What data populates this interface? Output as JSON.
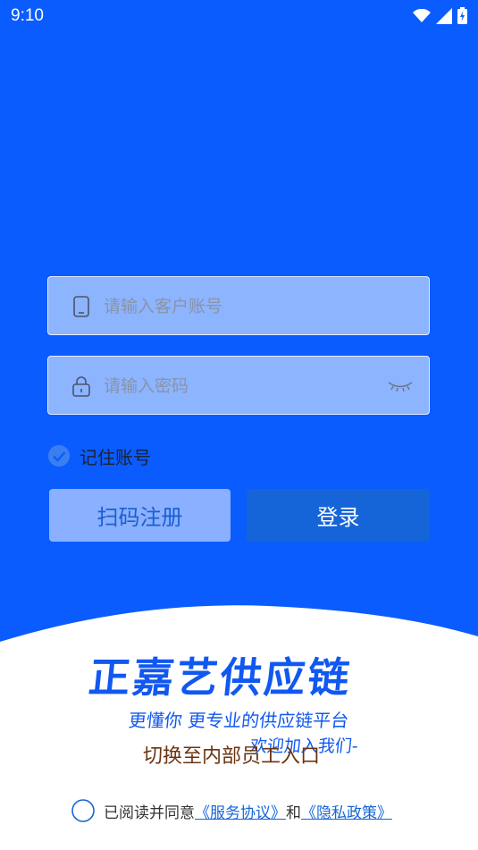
{
  "status_bar": {
    "time": "9:10"
  },
  "login_form": {
    "account_placeholder": "请输入客户账号",
    "password_placeholder": "请输入密码",
    "remember_label": "记住账号",
    "register_label": "扫码注册",
    "login_label": "登录"
  },
  "brand": {
    "name": "正嘉艺供应链",
    "slogan": "更懂你 更专业的供应链平台",
    "welcome": "欢迎加入我们-"
  },
  "switch_link": "切换至内部员工入口",
  "agreement": {
    "prefix": "已阅读并同意",
    "service_link": "《服务协议》",
    "and": "和",
    "privacy_link": "《隐私政策》"
  },
  "colors": {
    "background": "#0a5cff",
    "field_bg": "#8cb4ff",
    "login_button": "#1565d8",
    "register_button": "#8ab0ff",
    "switch_link_text": "#6b3410"
  }
}
